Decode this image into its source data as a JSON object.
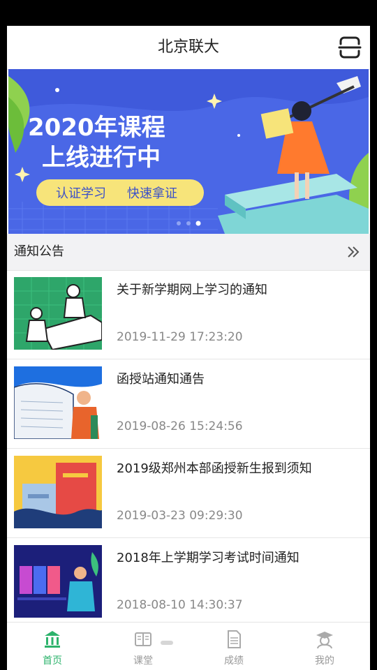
{
  "header": {
    "title": "北京联大"
  },
  "banner": {
    "line1": "2020年课程",
    "line2": "上线进行中",
    "tag1": "认证学习",
    "tag2": "快速拿证"
  },
  "section": {
    "label": "通知公告"
  },
  "notices": [
    {
      "title": "关于新学期网上学习的通知",
      "date": "2019-11-29 17:23:20"
    },
    {
      "title": "函授站通知通告",
      "date": "2019-08-26 15:24:56"
    },
    {
      "title": "2019级郑州本部函授新生报到须知",
      "date": "2019-03-23 09:29:30"
    },
    {
      "title": "2018年上学期学习考试时间通知",
      "date": "2018-08-10 14:30:37"
    }
  ],
  "tabs": [
    {
      "label": "首页",
      "icon": "home-icon",
      "active": true
    },
    {
      "label": "课堂",
      "icon": "book-icon",
      "active": false
    },
    {
      "label": "成绩",
      "icon": "grade-doc-icon",
      "active": false
    },
    {
      "label": "我的",
      "icon": "user-icon",
      "active": false
    }
  ],
  "colors": {
    "accent": "#2db36c",
    "banner_bg": "#4a67e6",
    "banner_text": "#ffffff",
    "tag_bg": "#f7e47a"
  }
}
